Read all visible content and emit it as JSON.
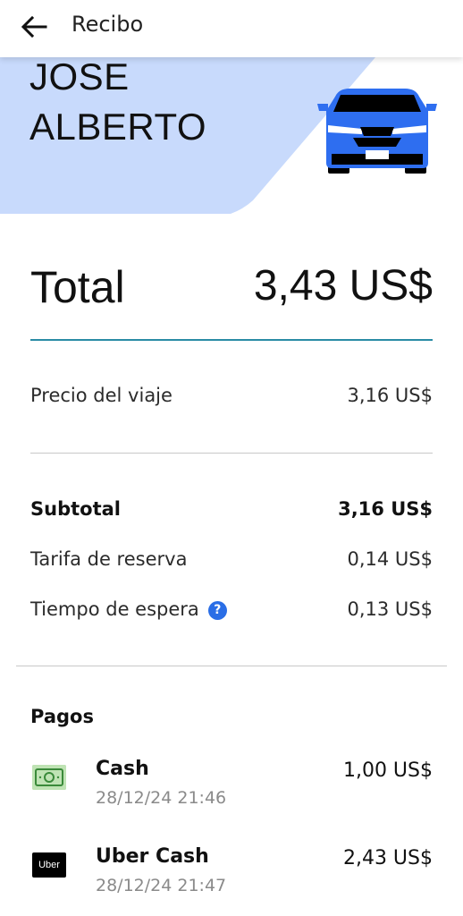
{
  "header": {
    "title": "Recibo",
    "back_icon": "arrow-left-icon"
  },
  "hero": {
    "driver_name_line1": "JOSE",
    "driver_name_line2": "ALBERTO",
    "background_color": "#c8dafc",
    "car_color": "#2e6ef0",
    "car_icon": "car-icon"
  },
  "total": {
    "label": "Total",
    "value": "3,43 US$"
  },
  "trip": {
    "label": "Precio del viaje",
    "value": "3,16 US$"
  },
  "breakdown": {
    "subtotal_label": "Subtotal",
    "subtotal_value": "3,16 US$",
    "booking_fee_label": "Tarifa de reserva",
    "booking_fee_value": "0,14 US$",
    "wait_time_label": "Tiempo de espera",
    "wait_time_value": "0,13 US$",
    "help_icon_glyph": "?"
  },
  "payments": {
    "title": "Pagos",
    "items": [
      {
        "name": "Cash",
        "date": "28/12/24 21:46",
        "amount": "1,00 US$",
        "icon": "cash-icon"
      },
      {
        "name": "Uber Cash",
        "date": "28/12/24 21:47",
        "amount": "2,43 US$",
        "icon": "uber-logo-icon",
        "icon_text": "Uber"
      }
    ]
  },
  "colors": {
    "accent_divider": "#2a8ba5",
    "help_icon": "#2a6ee6"
  }
}
